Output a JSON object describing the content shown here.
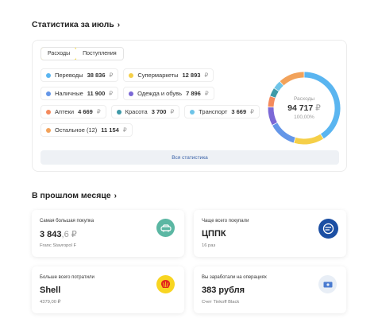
{
  "stats": {
    "title": "Статистика за июль",
    "tabs": [
      {
        "label": "Расходы",
        "active": true
      },
      {
        "label": "Поступления",
        "active": false
      }
    ],
    "categories": [
      {
        "name": "Переводы",
        "amount": "38 836",
        "color": "#5ab5f0"
      },
      {
        "name": "Супермаркеты",
        "amount": "12 893",
        "color": "#f5cf48"
      },
      {
        "name": "Наличные",
        "amount": "11 900",
        "color": "#6496e8"
      },
      {
        "name": "Одежда и обувь",
        "amount": "7 896",
        "color": "#7b68d6"
      },
      {
        "name": "Аптеки",
        "amount": "4 669",
        "color": "#f48a5c"
      },
      {
        "name": "Красота",
        "amount": "3 700",
        "color": "#3f9aa8"
      },
      {
        "name": "Транспорт",
        "amount": "3 669",
        "color": "#6ec4e8"
      },
      {
        "name": "Остальное (12)",
        "amount": "11 154",
        "color": "#f2a25a"
      }
    ],
    "currency": "₽",
    "total_label": "Расходы",
    "total_value": "94 717",
    "total_percent": "100,00%",
    "all_stats_label": "Вся статистика"
  },
  "last_month": {
    "title": "В прошлом месяце",
    "cards": {
      "biggest_purchase": {
        "caption": "Самая большая покупка",
        "value_main": "3 843",
        "value_fraction": ",6 ₽",
        "sub": "Franc Stavropol F",
        "icon_color": "#5bb7a3"
      },
      "most_often": {
        "caption": "Чаще всего покупали",
        "value": "ЦППК",
        "sub": "16 раз",
        "icon_color": "#1c4fa3"
      },
      "most_spent": {
        "caption": "Больше всего потратили",
        "value": "Shell",
        "sub": "4379,00 ₽",
        "icon_color": "#f8d521"
      },
      "earned": {
        "caption": "Вы заработали на операциях",
        "value": "383 рубля",
        "sub": "Счет Tinkoff Black",
        "icon_color": "#e8eef6"
      }
    }
  }
}
